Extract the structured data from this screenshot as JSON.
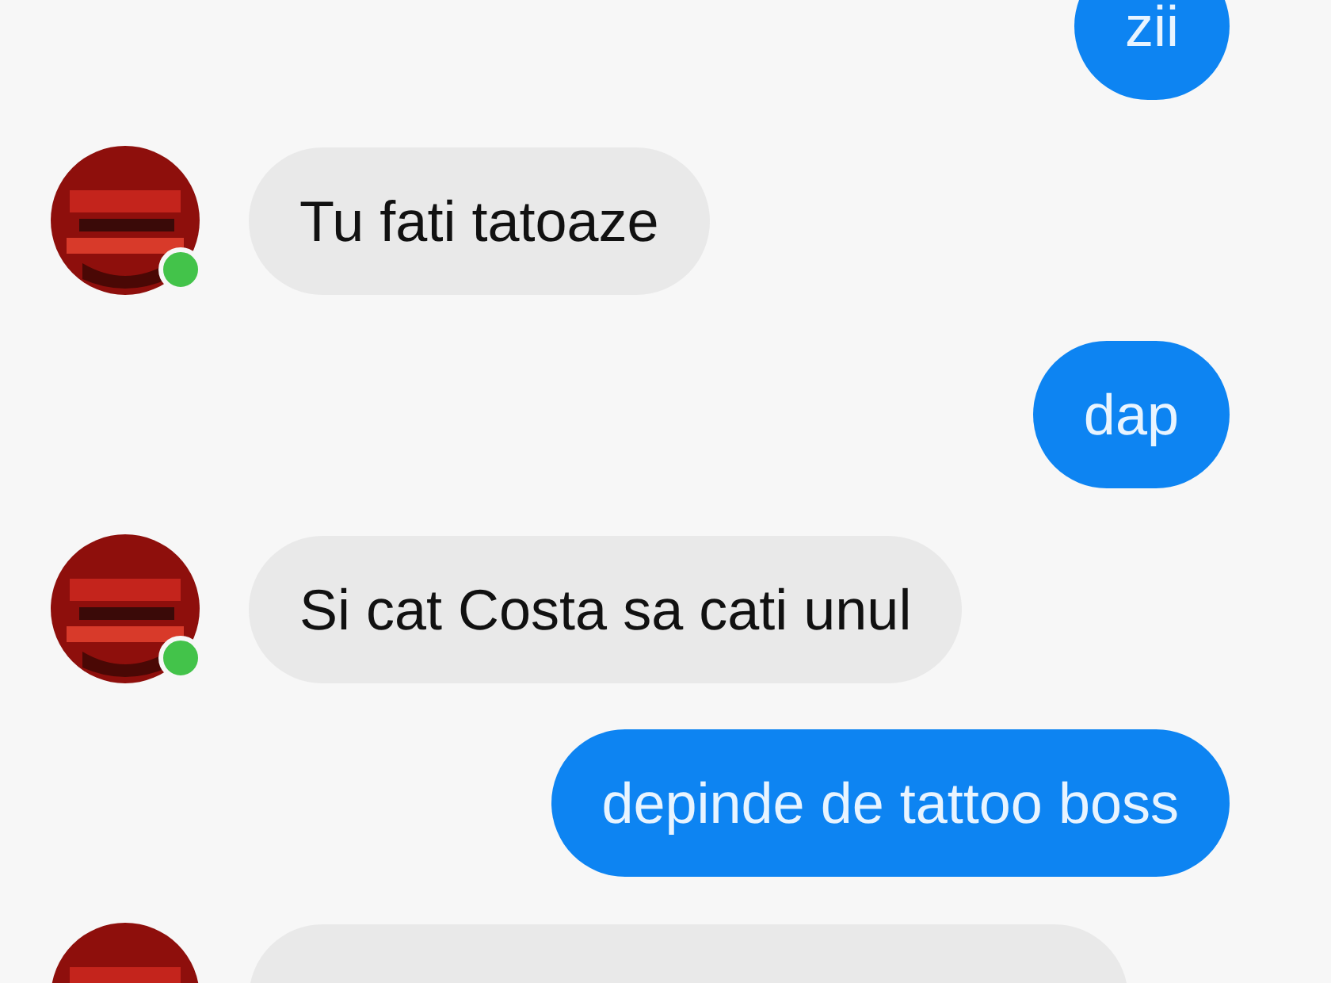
{
  "messages": [
    {
      "kind": "sent",
      "text": "zii"
    },
    {
      "kind": "received",
      "text": "Tu fati tatoaze",
      "online": true
    },
    {
      "kind": "sent",
      "text": "dap"
    },
    {
      "kind": "received",
      "text": "Si cat Costa sa cati unul",
      "online": true
    },
    {
      "kind": "sent",
      "text": "depinde de tattoo boss"
    },
    {
      "kind": "received"
    }
  ]
}
